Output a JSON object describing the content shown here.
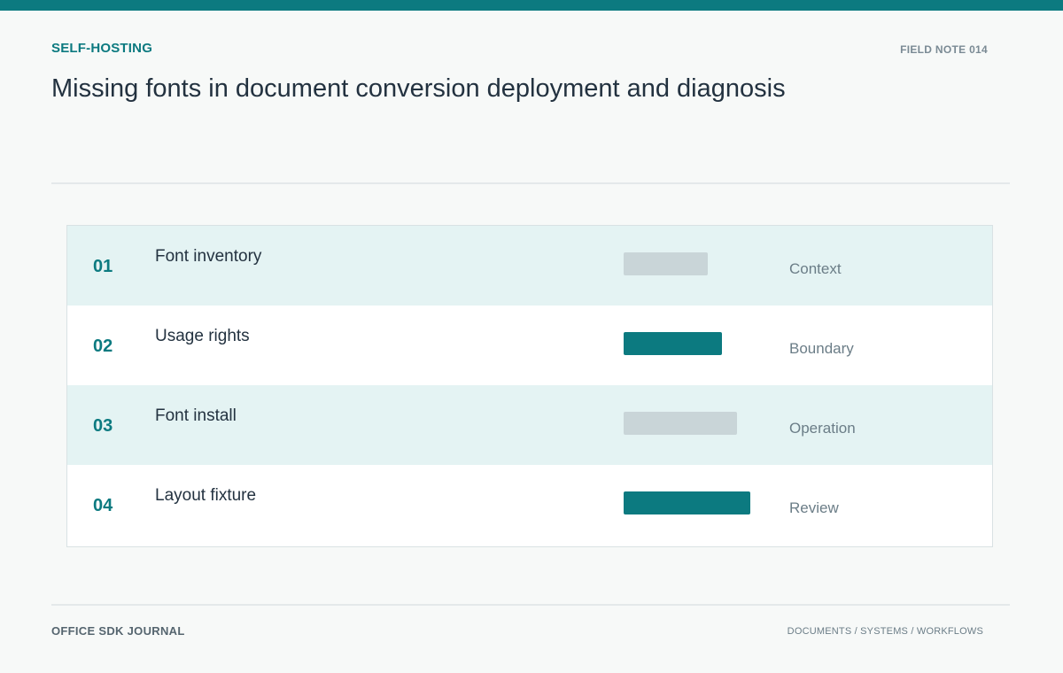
{
  "header": {
    "section_label": "SELF-HOSTING",
    "field_note": "FIELD NOTE 014",
    "title": "Missing fonts in document conversion deployment and diagnosis"
  },
  "rows": [
    {
      "number": "01",
      "name": "Font inventory",
      "level": 0.63,
      "style": "muted",
      "tag": "Context"
    },
    {
      "number": "02",
      "name": "Usage rights",
      "level": 0.74,
      "style": "strong",
      "tag": "Boundary"
    },
    {
      "number": "03",
      "name": "Font install",
      "level": 0.85,
      "style": "muted",
      "tag": "Operation"
    },
    {
      "number": "04",
      "name": "Layout fixture",
      "level": 0.95,
      "style": "strong",
      "tag": "Review"
    }
  ],
  "footer": {
    "publication": "OFFICE SDK JOURNAL",
    "topics": "DOCUMENTS / SYSTEMS / WORKFLOWS"
  },
  "colors": {
    "accent": "#0c7a80",
    "muted_bar": "#c9d5d8",
    "shaded_row": "#e4f3f3"
  }
}
